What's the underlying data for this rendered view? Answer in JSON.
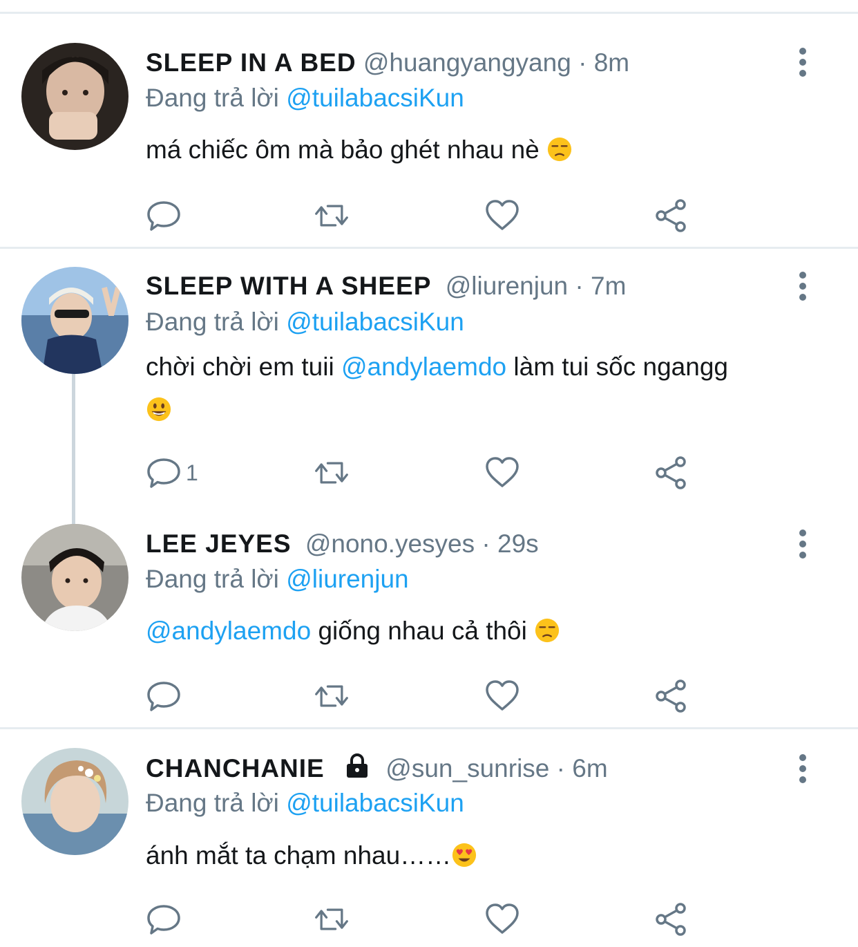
{
  "tweets": [
    {
      "name": "SLEEP IN A BED",
      "handle": "@huangyangyang",
      "time": "8m",
      "replying_label": "Đang trả lời",
      "replying_to": "@tuilabacsiKun",
      "text": "má chiếc ôm mà bảo ghét nhau nè",
      "emoji": "unamused-face",
      "reply_count": ""
    },
    {
      "name": "SLEEP WITH A SHEEP",
      "handle": "@liurenjun",
      "time": "7m",
      "replying_label": "Đang trả lời",
      "replying_to": "@tuilabacsiKun",
      "text_before": "chời chời em tuii",
      "mention": "@andylaemdo",
      "text_after": "làm tui sốc ngangg",
      "emoji": "grinning-face",
      "reply_count": "1"
    },
    {
      "name": "LEE JEYES",
      "handle": "@nono.yesyes",
      "time": "29s",
      "replying_label": "Đang trả lời",
      "replying_to": "@liurenjun",
      "mention": "@andylaemdo",
      "text_after": "giống nhau cả thôi",
      "emoji": "unamused-face",
      "reply_count": ""
    },
    {
      "name": "CHANCHANIE",
      "handle": "@sun_sunrise",
      "time": "6m",
      "locked": true,
      "replying_label": "Đang trả lời",
      "replying_to": "@tuilabacsiKun",
      "text": "ánh mắt ta chạm nhau……",
      "emoji": "heart-eyes-face",
      "reply_count": ""
    }
  ],
  "icons": {
    "reply": "reply-icon",
    "retweet": "retweet-icon",
    "like": "heart-icon",
    "share": "share-icon",
    "more": "more-vertical-icon",
    "lock": "lock-icon"
  },
  "colors": {
    "link": "#1da1f2",
    "secondary": "#657786",
    "divider": "#e6ecf0"
  }
}
